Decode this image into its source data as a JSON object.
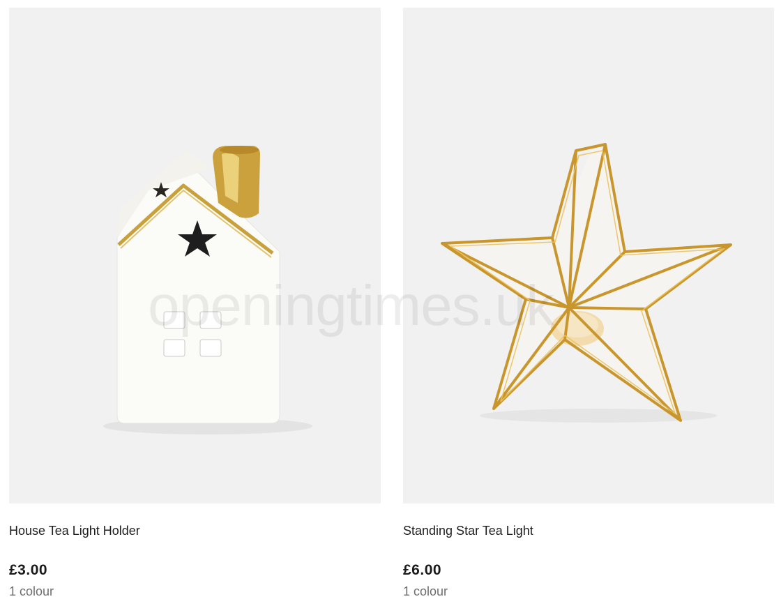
{
  "products": [
    {
      "name": "House Tea Light Holder",
      "price": "£3.00",
      "colours": "1 colour",
      "image_alt": "house-tealight-image"
    },
    {
      "name": "Standing Star Tea Light",
      "price": "£6.00",
      "colours": "1 colour",
      "image_alt": "star-tealight-image"
    }
  ],
  "watermark": "openingtimes.uk"
}
